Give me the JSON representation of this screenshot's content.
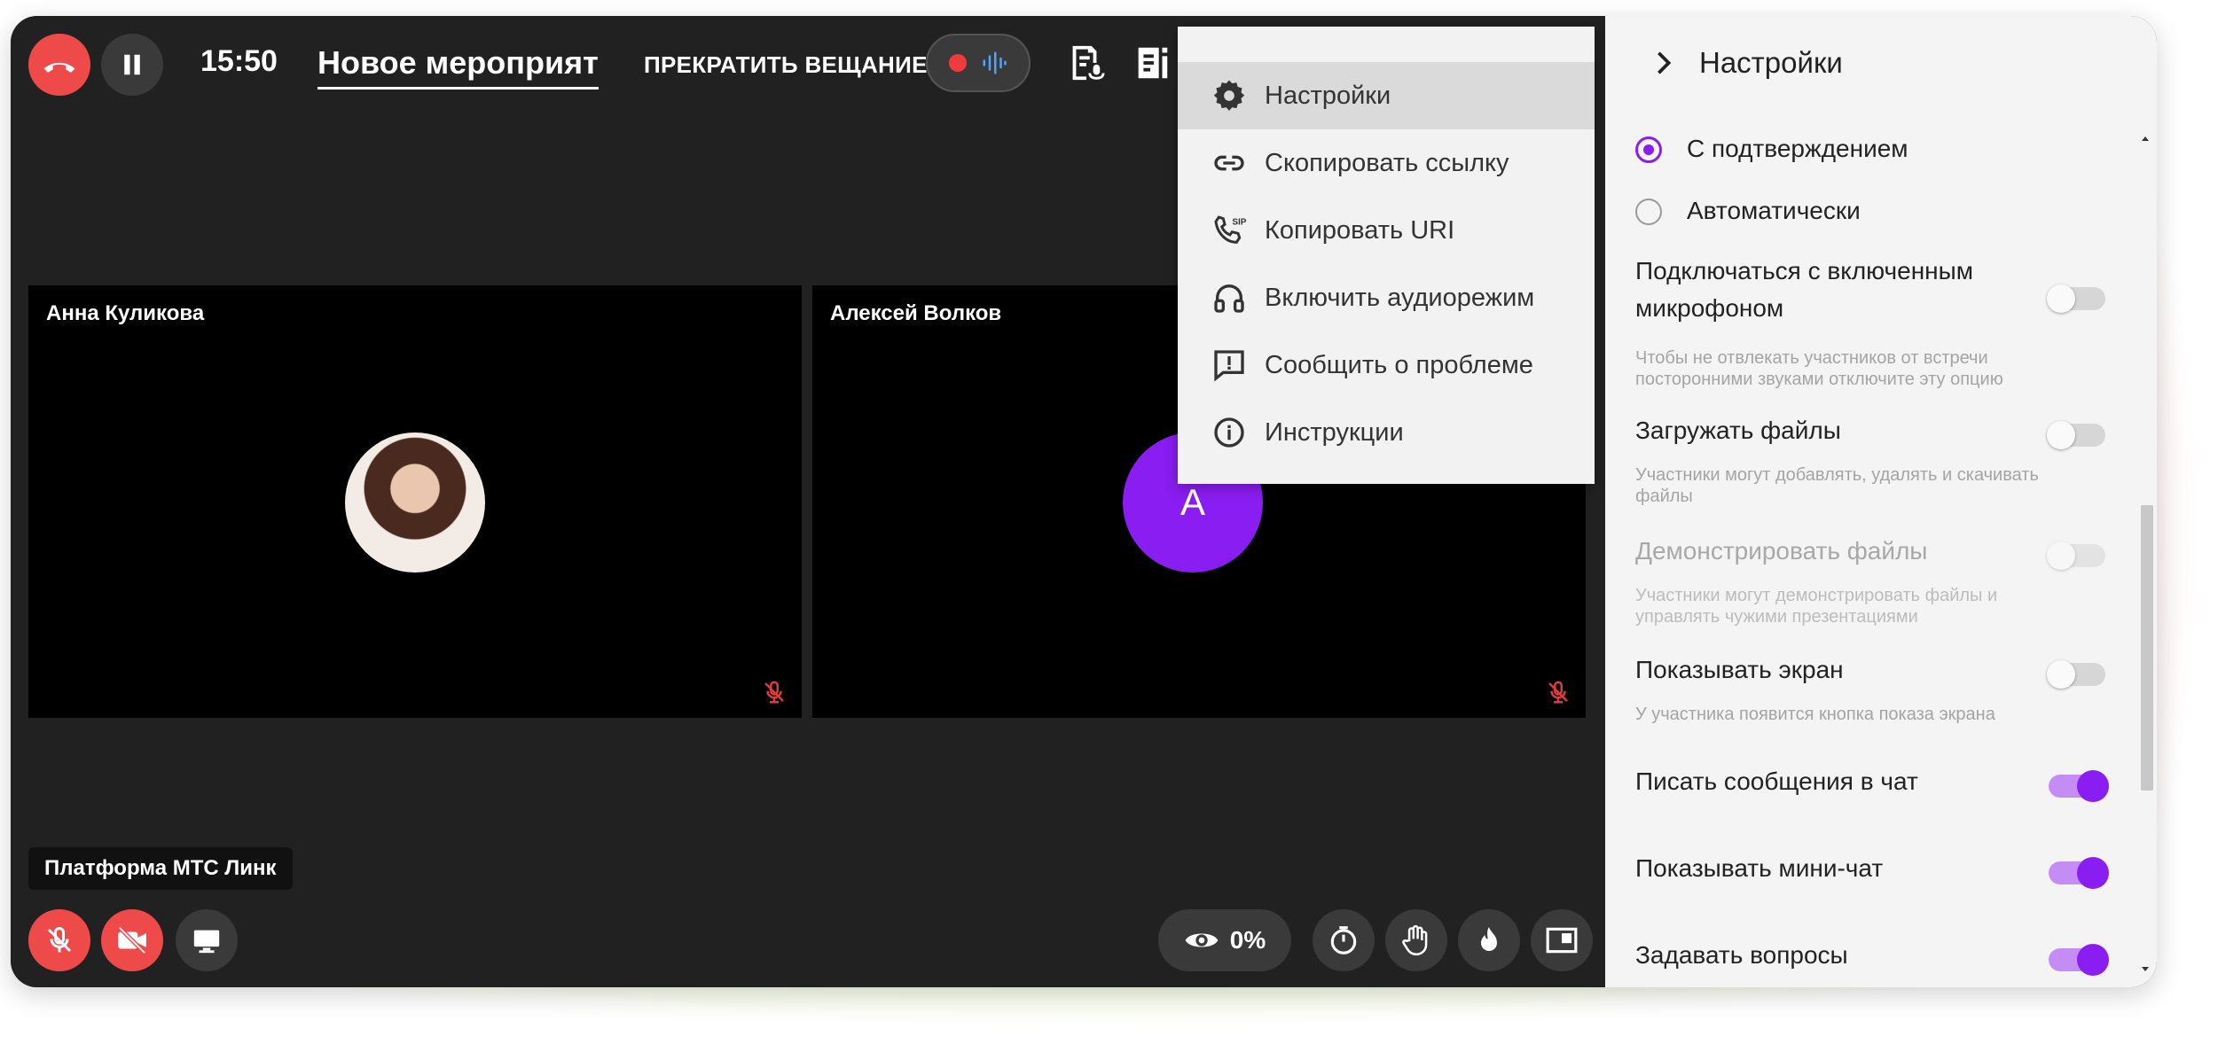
{
  "topbar": {
    "time": "15:50",
    "event_title": "Новое мероприят",
    "stop_broadcast_label": "ПРЕКРАТИТЬ ВЕЩАНИЕ"
  },
  "participants": [
    {
      "name": "Анна Куликова",
      "avatar": "photo"
    },
    {
      "name": "Алексей Волков",
      "avatar_letter": "А"
    }
  ],
  "bottombar": {
    "platform_label": "Платформа МТС Линк",
    "views_percent": "0%"
  },
  "menu": {
    "items": [
      {
        "label": "Настройки",
        "icon": "gear-icon",
        "active": true
      },
      {
        "label": "Скопировать ссылку",
        "icon": "link-icon"
      },
      {
        "label": "Копировать URI",
        "icon": "sip-phone-icon"
      },
      {
        "label": "Включить аудиорежим",
        "icon": "headphones-icon"
      },
      {
        "label": "Сообщить о проблеме",
        "icon": "report-icon"
      },
      {
        "label": "Инструкции",
        "icon": "info-icon"
      }
    ]
  },
  "settings": {
    "title": "Настройки",
    "radio_options": [
      {
        "label": "С подтверждением",
        "selected": true
      },
      {
        "label": "Автоматически",
        "selected": false
      }
    ],
    "items": [
      {
        "label_line1": "Подключаться с включенным",
        "label_line2": "микрофоном",
        "hint": "Чтобы не отвлекать участников от встречи посторонними звуками отключите эту опцию",
        "enabled": false
      },
      {
        "label": "Загружать файлы",
        "hint": "Участники могут добавлять, удалять и скачивать файлы",
        "enabled": false
      },
      {
        "label": "Демонстрировать файлы",
        "hint": "Участники могут демонстрировать файлы и управлять чужими презентациями",
        "enabled": false,
        "disabled": true
      },
      {
        "label": "Показывать экран",
        "hint": "У участника появится кнопка показа экрана",
        "enabled": false
      },
      {
        "label": "Писать сообщения в чат",
        "enabled": true
      },
      {
        "label": "Показывать мини-чат",
        "enabled": true
      },
      {
        "label": "Задавать вопросы",
        "enabled": true
      }
    ]
  },
  "colors": {
    "accent": "#8a1df2",
    "danger": "#ef4a4a",
    "stage_bg": "#212121"
  }
}
